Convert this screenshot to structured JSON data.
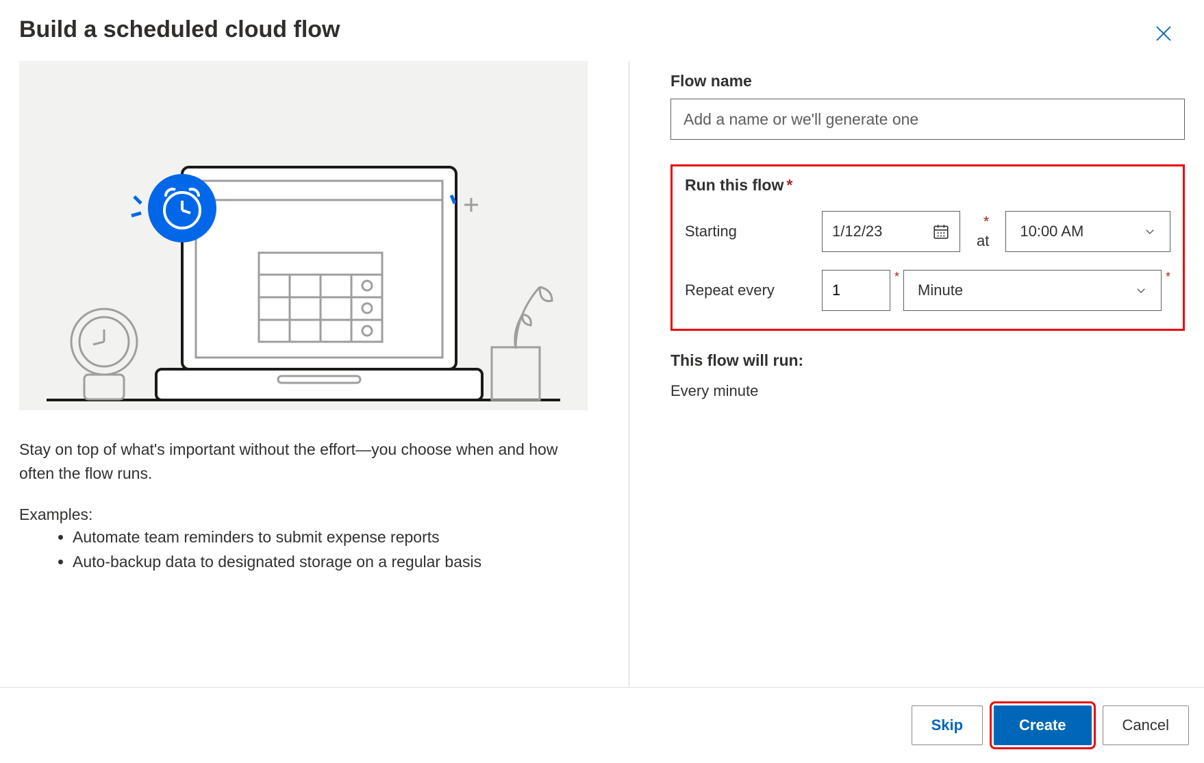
{
  "header": {
    "title": "Build a scheduled cloud flow"
  },
  "left": {
    "description": "Stay on top of what's important without the effort—you choose when and how often the flow runs.",
    "examples_label": "Examples:",
    "examples": [
      "Automate team reminders to submit expense reports",
      "Auto-backup data to designated storage on a regular basis"
    ]
  },
  "right": {
    "flow_name_label": "Flow name",
    "flow_name_placeholder": "Add a name or we'll generate one",
    "flow_name_value": "",
    "run_section_title": "Run this flow",
    "starting_label": "Starting",
    "starting_date": "1/12/23",
    "at_label": "at",
    "starting_time": "10:00 AM",
    "repeat_label": "Repeat every",
    "repeat_value": "1",
    "repeat_unit": "Minute",
    "summary_title": "This flow will run:",
    "summary_text": "Every minute"
  },
  "footer": {
    "skip": "Skip",
    "create": "Create",
    "cancel": "Cancel"
  }
}
